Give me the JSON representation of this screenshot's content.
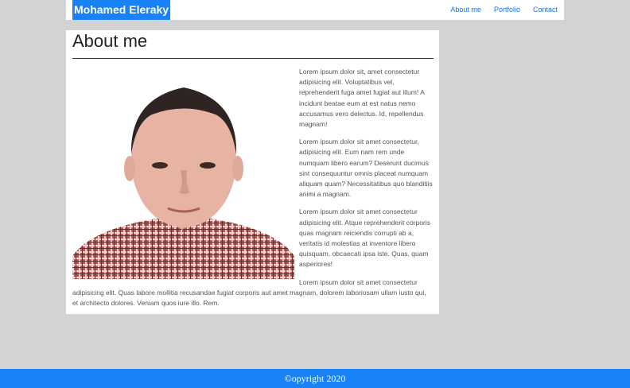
{
  "nav": {
    "brand": "Mohamed Eleraky",
    "links": [
      "About me",
      "Portfolio",
      "Contact"
    ]
  },
  "about": {
    "title": "About me",
    "paragraphs": [
      "Lorem ipsum dolor sit, amet consectetur adipisicing elit. Voluptatibus vel, reprehenderit fuga amet fugiat aut illum! A incidunt beatae eum at est natus nemo accusamus vero delectus. Id, repellendus magnam!",
      "Lorem ipsum dolor sit amet consectetur, adipisicing elit. Eum nam rem unde numquam libero earum? Deserunt ducimus sint consequuntur omnis placeat numquam aliquam quam? Necessitatibus quo blanditiis animi a magnam.",
      "Lorem ipsum dolor sit amet consectetur adipisicing elit. Atque reprehenderit corporis quas magnam reiciendis corrupti ab a, veritatis id molestias at inventore libero quisquam, obcaecati ipsa iste. Quas, quam asperiores!",
      "Lorem ipsum dolor sit amet consectetur adipisicing elit. Quas labore mollitia recusandae fugiat corporis aut amet magnam, dolorem laboriosam ullam iusto qui, et architecto dolores. Veniam quos iure illo. Rem."
    ]
  },
  "footer": {
    "text": "©opyright 2020"
  },
  "colors": {
    "brand": "#1a82f7",
    "background": "#d3d3d3"
  }
}
